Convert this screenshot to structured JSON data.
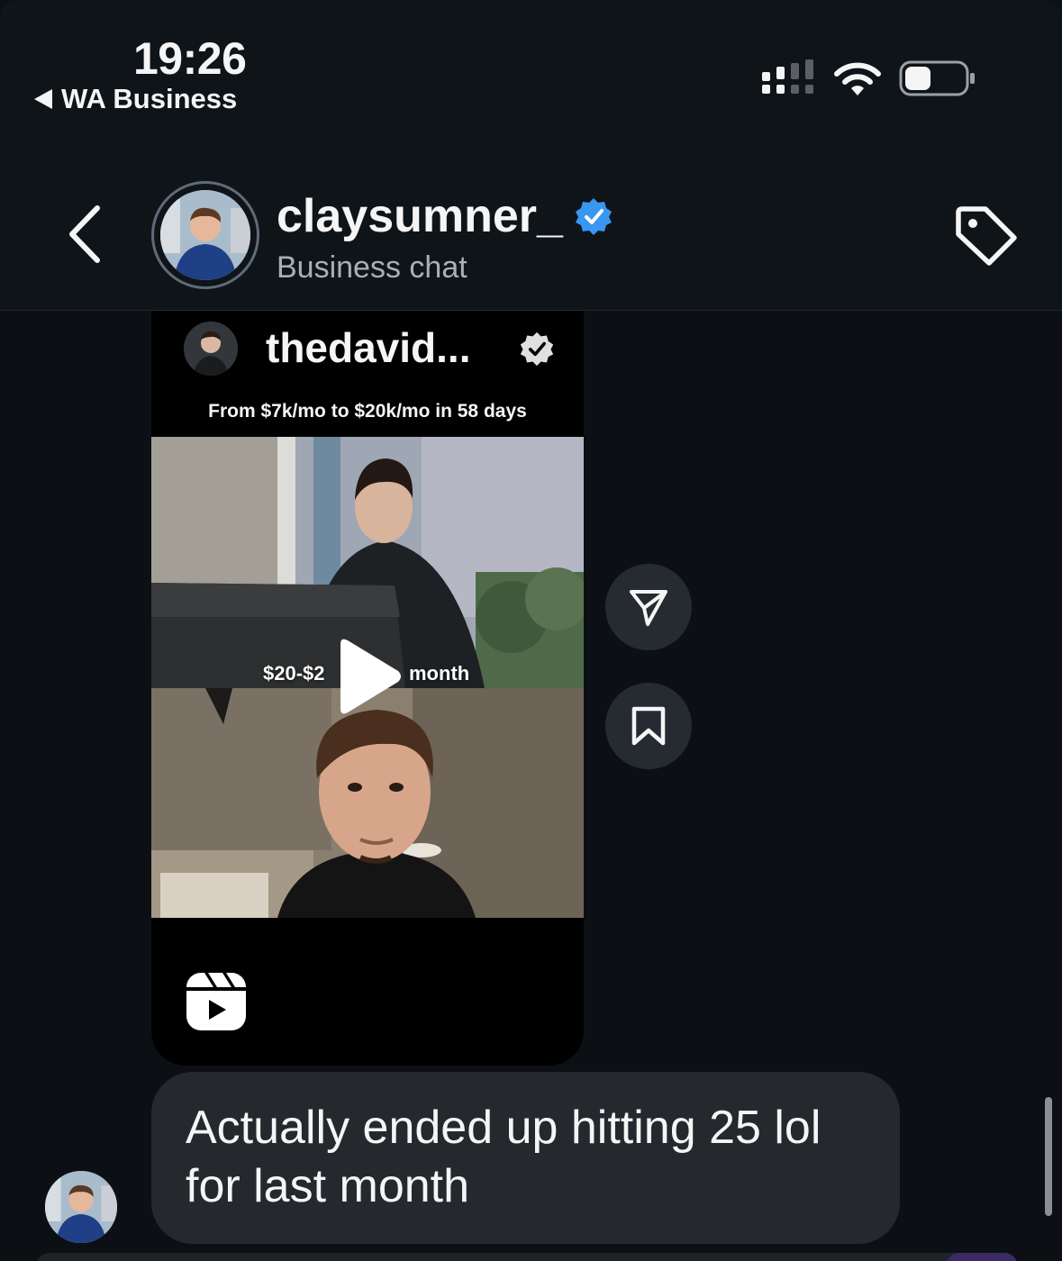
{
  "status_bar": {
    "time": "19:26",
    "back_app": "WA Business",
    "icons": [
      "signal-icon",
      "wifi-icon",
      "battery-icon"
    ]
  },
  "header": {
    "username": "claysumner_",
    "subtitle": "Business chat",
    "verified": true,
    "icons": [
      "back-chevron-icon",
      "verified-badge-icon",
      "tag-icon"
    ]
  },
  "reel": {
    "owner": "thedavid...",
    "caption": "From $7k/mo to $20k/mo in 58 days",
    "overlay_left": "$20-$2",
    "overlay_right": "month",
    "icons": [
      "play-icon",
      "reels-icon",
      "verified-badge-icon"
    ]
  },
  "actions": {
    "icons": [
      "share-send-icon",
      "bookmark-icon"
    ]
  },
  "messages": [
    {
      "sender": "claysumner_",
      "text": "Actually ended up hitting 25 lol for last month"
    }
  ],
  "colors": {
    "background": "#0c1014",
    "bubble": "#25292e",
    "verified_blue": "#3897f0",
    "action_button": "#262b31"
  }
}
